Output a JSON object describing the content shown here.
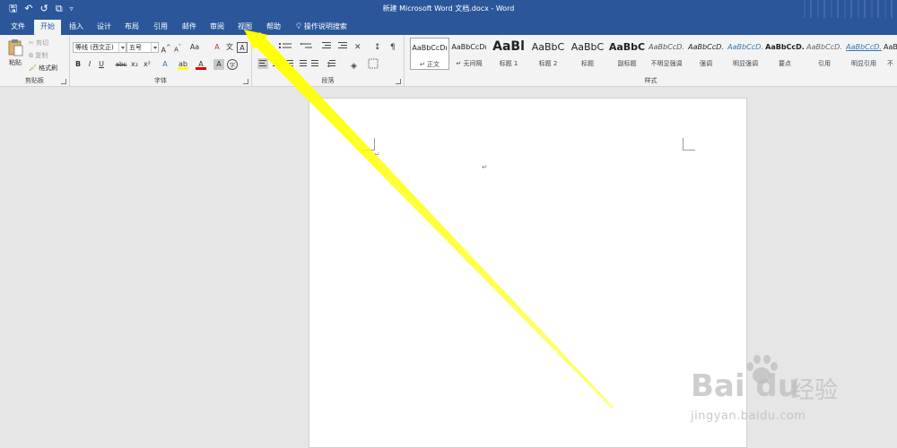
{
  "title_bar": {
    "title": "新建 Microsoft Word 文档.docx  -  Word",
    "qat": {
      "save_icon": "floppy-icon",
      "undo_icon": "undo-icon",
      "redo_icon": "redo-icon",
      "touch_icon": "touch-mode-icon",
      "customize_icon": "qat-customize-icon"
    }
  },
  "tabs": [
    {
      "label": "文件"
    },
    {
      "label": "开始",
      "active": true
    },
    {
      "label": "插入"
    },
    {
      "label": "设计"
    },
    {
      "label": "布局"
    },
    {
      "label": "引用"
    },
    {
      "label": "邮件"
    },
    {
      "label": "审阅"
    },
    {
      "label": "视图"
    },
    {
      "label": "帮助"
    },
    {
      "label": "操作说明搜索"
    }
  ],
  "ribbon": {
    "clipboard": {
      "label": "剪贴板",
      "paste": "粘贴",
      "cut": "剪切",
      "copy": "复制",
      "format_painter": "格式刷"
    },
    "font": {
      "label": "字体",
      "font_name": "等线 (西文正)",
      "font_size": "五号",
      "grow": "A",
      "shrink": "A",
      "change_case": "Aa",
      "bold": "B",
      "italic": "I",
      "underline": "U",
      "strikethrough": "abc",
      "subscript": "x₂",
      "superscript": "x²",
      "text_effect": "A",
      "highlight": "ab",
      "font_color": "A",
      "char_shading": "A",
      "enclose": "字",
      "clear": "A",
      "phonetic": "文",
      "border": "A"
    },
    "paragraph": {
      "label": "段落"
    },
    "styles": {
      "label": "样式",
      "items": [
        {
          "preview": "AaBbCcDı",
          "name": "↵ 正文",
          "selected": true
        },
        {
          "preview": "AaBbCcDı",
          "name": "↵ 无间隔"
        },
        {
          "preview": "AaBl",
          "name": "标题 1"
        },
        {
          "preview": "AaBbC",
          "name": "标题 2"
        },
        {
          "preview": "AaBbC",
          "name": "标题"
        },
        {
          "preview": "AaBbC",
          "name": "副标题"
        },
        {
          "preview": "AaBbCcD.",
          "name": "不明显强调"
        },
        {
          "preview": "AaBbCcD.",
          "name": "强调"
        },
        {
          "preview": "AaBbCcD.",
          "name": "明显强调"
        },
        {
          "preview": "AaBbCcD.",
          "name": "要点"
        },
        {
          "preview": "AaBbCcD.",
          "name": "引用"
        },
        {
          "preview": "AaBbCcD.",
          "name": "明显引用"
        },
        {
          "preview": "AaB",
          "name": "不"
        }
      ]
    }
  },
  "document": {
    "paragraph_mark_1": "↵",
    "paragraph_mark_2": "↵"
  },
  "watermark": {
    "logo": "Bai  du",
    "brand_cn": "经验",
    "url": "jingyan.baidu.com"
  },
  "colors": {
    "accent": "#2b579a",
    "arrow": "#ffff00"
  }
}
